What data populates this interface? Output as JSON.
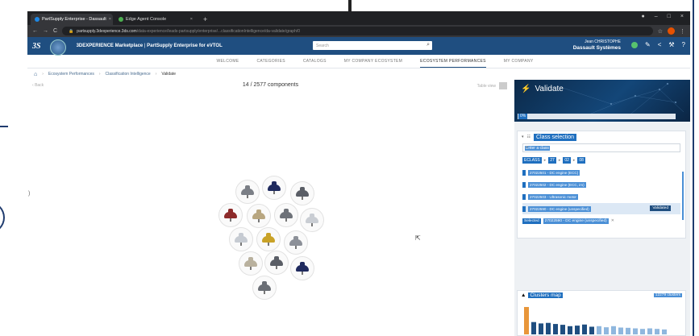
{
  "browser": {
    "tabs": [
      {
        "label": "PartSupply Enterprise - Dassault",
        "active": true
      },
      {
        "label": "Edge Agent Console",
        "active": false
      }
    ],
    "new_tab": "+",
    "url_host": "partsupply.3dexperience.3ds.com",
    "url_path": "/data-experience/leads-partsupply/enterprise/...classificationIntelligence/da-validate/graph/0"
  },
  "app": {
    "brand": "3DEXPERIENCE Marketplace",
    "subtitle": "PartSupply Enterprise for eVTOL",
    "search_placeholder": "Search",
    "user_name": "Jean CHRISTOPHE",
    "company": "Dassault Systèmes"
  },
  "nav": {
    "items": [
      "WELCOME",
      "CATEGORIES",
      "CATALOGS",
      "MY COMPANY ECOSYSTEM",
      "ECOSYSTEM PERFORMANCES",
      "MY COMPANY"
    ],
    "active": "ECOSYSTEM PERFORMANCES"
  },
  "breadcrumb": [
    "Ecosystem Performances",
    "Classification Intelligence",
    "Validate"
  ],
  "main": {
    "back": "Back",
    "count": "14 / 2577 components",
    "table_view": "Table view"
  },
  "panel": {
    "title": "Validate",
    "progress": "0%",
    "class_selection_title": "Class selection",
    "class_input_placeholder": "Enter a class",
    "eclass_path": [
      "ECLASS",
      "27",
      "02",
      "08"
    ],
    "classes": [
      {
        "label": "27022501 - DC engine (ECC)",
        "selected": false
      },
      {
        "label": "27022502 - DC engine (ECC, im)",
        "selected": false
      },
      {
        "label": "27022503 - Ultrasonic motor",
        "selected": false
      },
      {
        "label": "27022590 - DC engine (unspecified)",
        "selected": true
      }
    ],
    "validated_label": "Validated",
    "selected_label": "Selected",
    "selected_value": "27022590 - DC engine (unspecified)",
    "clusters_title": "Clusters map",
    "clusters_count": "12279 clusters"
  },
  "colors": {
    "header_blue": "#1f4e80",
    "accent_blue": "#1f6fbf",
    "highlight_blue": "#4a8fd6",
    "orange_bar": "#e8963a"
  },
  "bubbles": [
    {
      "color": "#7b7f86",
      "kind": "gray"
    },
    {
      "color": "#1f2a5e",
      "kind": "navy"
    },
    {
      "color": "#5a5e66",
      "kind": "gray"
    },
    {
      "color": "#8c2a2a",
      "kind": "red"
    },
    {
      "color": "#b8a680",
      "kind": "tan"
    },
    {
      "color": "#6e7279",
      "kind": "gray"
    },
    {
      "color": "#c9cdd3",
      "kind": "silver"
    },
    {
      "color": "#c6cbd2",
      "kind": "silver"
    },
    {
      "color": "#c9a227",
      "kind": "gold"
    },
    {
      "color": "#8c9098",
      "kind": "gray"
    },
    {
      "color": "#b9b19e",
      "kind": "tan"
    },
    {
      "color": "#5a5e66",
      "kind": "gray"
    },
    {
      "color": "#1f2a5e",
      "kind": "navy"
    },
    {
      "color": "#6a6e75",
      "kind": "gray"
    }
  ],
  "cluster_bars": [
    1.0,
    0.45,
    0.4,
    0.42,
    0.38,
    0.35,
    0.3,
    0.32,
    0.36,
    0.28,
    0.3,
    0.26,
    0.3,
    0.25,
    0.24,
    0.22,
    0.2,
    0.22,
    0.2,
    0.18
  ]
}
